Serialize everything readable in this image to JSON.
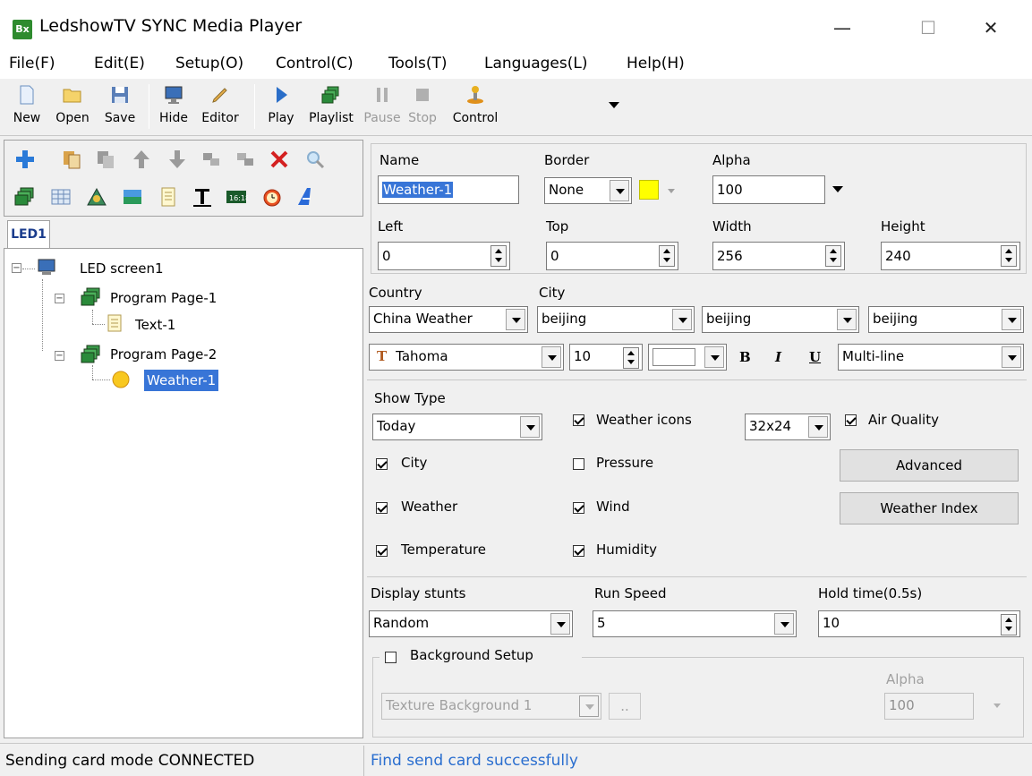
{
  "window": {
    "title": "LedshowTV SYNC Media Player",
    "minimize": "—",
    "maximize": "☐",
    "close": "✕"
  },
  "menu": [
    "File(F)",
    "Edit(E)",
    "Setup(O)",
    "Control(C)",
    "Tools(T)",
    "Languages(L)",
    "Help(H)"
  ],
  "toolbar": {
    "new": "New",
    "open": "Open",
    "save": "Save",
    "hide": "Hide",
    "editor": "Editor",
    "play": "Play",
    "playlist": "Playlist",
    "pause": "Pause",
    "stop": "Stop",
    "control": "Control"
  },
  "tab": "LED1",
  "tree": {
    "screen": "LED screen1",
    "page1": "Program Page-1",
    "text1": "Text-1",
    "page2": "Program Page-2",
    "weather1": "Weather-1"
  },
  "props": {
    "name_label": "Name",
    "name_value": "Weather-1",
    "border_label": "Border",
    "border_value": "None",
    "alpha_label": "Alpha",
    "alpha_value": "100",
    "left_label": "Left",
    "left_value": "0",
    "top_label": "Top",
    "top_value": "0",
    "width_label": "Width",
    "width_value": "256",
    "height_label": "Height",
    "height_value": "240",
    "border_color": "#ffff00"
  },
  "weather": {
    "country_label": "Country",
    "country_value": "China Weather",
    "city_label": "City",
    "city1": "beijing",
    "city2": "beijing",
    "city3": "beijing",
    "font": "Tahoma",
    "font_size": "10",
    "bold": "B",
    "italic": "I",
    "underline": "U",
    "line_mode": "Multi-line",
    "show_type_label": "Show Type",
    "show_type_value": "Today",
    "weather_icons_label": "Weather icons",
    "icon_size": "32x24",
    "air_quality_label": "Air Quality",
    "city_chk": "City",
    "pressure_chk": "Pressure",
    "advanced_btn": "Advanced",
    "weather_chk": "Weather",
    "wind_chk": "Wind",
    "weather_index_btn": "Weather Index",
    "temperature_chk": "Temperature",
    "humidity_chk": "Humidity"
  },
  "display": {
    "stunts_label": "Display stunts",
    "stunts_value": "Random",
    "speed_label": "Run Speed",
    "speed_value": "5",
    "hold_label": "Hold time(0.5s)",
    "hold_value": "10",
    "bg_label": "Background Setup",
    "bg_texture": "Texture Background 1",
    "bg_browse": "..",
    "bg_alpha_label": "Alpha",
    "bg_alpha_value": "100"
  },
  "status": {
    "left": "Sending card mode CONNECTED",
    "right": "Find send card successfully"
  }
}
